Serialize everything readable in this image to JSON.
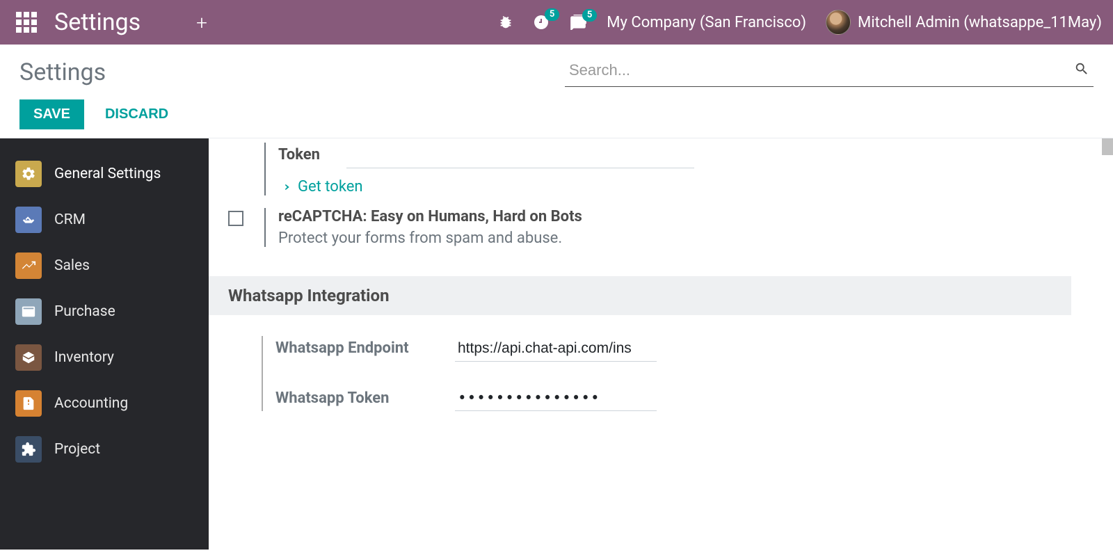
{
  "navbar": {
    "title": "Settings",
    "activity_badge": "5",
    "messages_badge": "5",
    "company": "My Company (San Francisco)",
    "username": "Mitchell Admin (whatsappe_11May)"
  },
  "control_panel": {
    "breadcrumb": "Settings",
    "search_placeholder": "Search...",
    "save_label": "SAVE",
    "discard_label": "DISCARD"
  },
  "sidebar": {
    "items": [
      {
        "label": "General Settings"
      },
      {
        "label": "CRM"
      },
      {
        "label": "Sales"
      },
      {
        "label": "Purchase"
      },
      {
        "label": "Inventory"
      },
      {
        "label": "Accounting"
      },
      {
        "label": "Project"
      }
    ]
  },
  "content": {
    "token_label": "Token",
    "token_value": "",
    "get_token_link": "Get token",
    "recaptcha_title": "reCAPTCHA: Easy on Humans, Hard on Bots",
    "recaptcha_desc": "Protect your forms from spam and abuse.",
    "whatsapp_section": "Whatsapp Integration",
    "wa_endpoint_label": "Whatsapp Endpoint",
    "wa_endpoint_value": "https://api.chat-api.com/ins",
    "wa_token_label": "Whatsapp Token",
    "wa_token_value": "•••••••••••••••"
  }
}
